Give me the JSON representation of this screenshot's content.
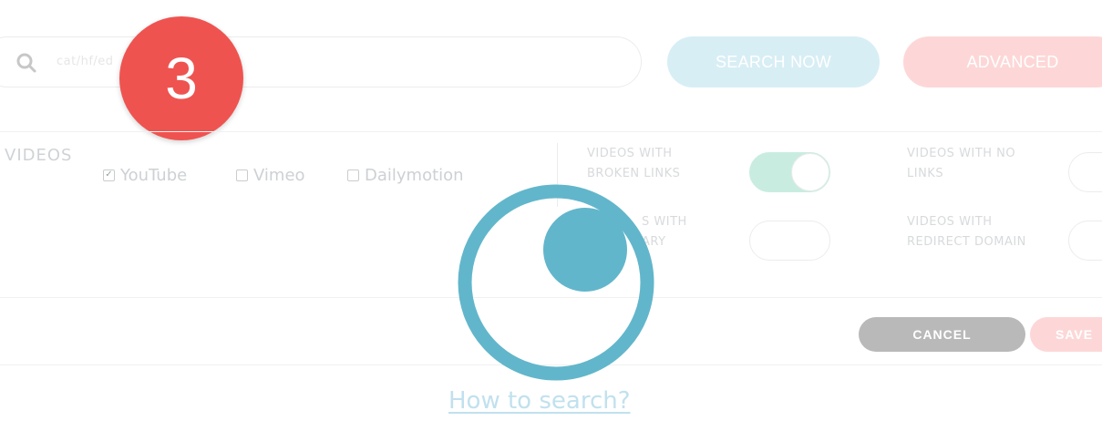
{
  "search": {
    "icon": "search-icon",
    "query": "cat/hf/ed"
  },
  "buttons": {
    "search_now": "SEARCH NOW",
    "advanced": "ADVANCED",
    "cancel": "CANCEL",
    "save": "SAVE"
  },
  "badge": {
    "number": "3",
    "color": "#ef5350"
  },
  "videos": {
    "section_label": "VIDEOS",
    "platforms": [
      {
        "label": "YouTube",
        "checked": true
      },
      {
        "label": "Vimeo",
        "checked": false
      },
      {
        "label": "Dailymotion",
        "checked": false
      }
    ]
  },
  "options": [
    {
      "label_line1": "VIDEOS WITH",
      "label_line2": "BROKEN LINKS",
      "on": true
    },
    {
      "label_line1": "VIDEOS WITH NO",
      "label_line2": "LINKS",
      "on": false
    },
    {
      "label_line1": "S WITH",
      "label_line2": "ARY",
      "on": false
    },
    {
      "label_line1": "VIDEOS WITH",
      "label_line2": "REDIRECT DOMAIN",
      "on": false
    }
  ],
  "help_link": "How to search?",
  "colors": {
    "accent_teal": "#62b6cb",
    "toggle_on": "#c8ede0",
    "badge_red": "#ef5350"
  },
  "overlay": {
    "icon": "loading-spinner-icon"
  }
}
